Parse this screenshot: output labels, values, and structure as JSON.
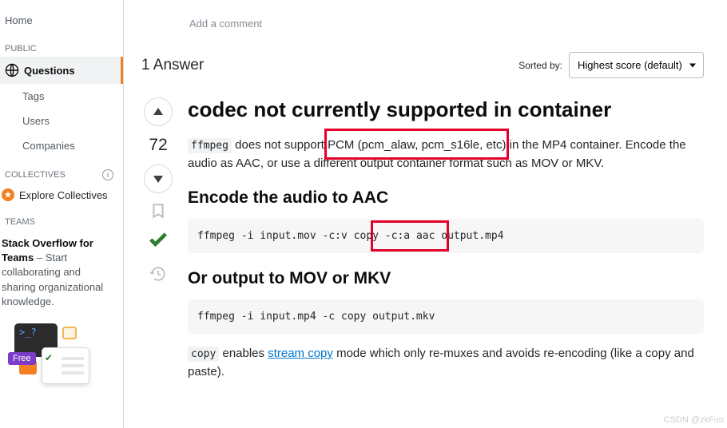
{
  "sidebar": {
    "home": "Home",
    "public_label": "PUBLIC",
    "questions": "Questions",
    "tags": "Tags",
    "users": "Users",
    "companies": "Companies",
    "collectives_label": "COLLECTIVES",
    "explore_collectives": "Explore Collectives",
    "teams_label": "TEAMS",
    "teams_promo_bold": "Stack Overflow for Teams",
    "teams_promo_rest": " – Start collaborating and sharing organizational knowledge.",
    "free_tag": "Free",
    "terminal_prompt": ">_",
    "terminal_q": "?"
  },
  "comment_cta": "Add a comment",
  "answers": {
    "count_label": "1 Answer",
    "sorted_by": "Sorted by:",
    "sort_option": "Highest score (default)"
  },
  "vote": {
    "score": "72"
  },
  "answer": {
    "title": "codec not currently supported in container",
    "para1_pre": " does not support ",
    "para1_pcm": "PCM (pcm_alaw, pcm_s16le, etc)",
    "para1_post": " in the MP4 container. Encode the audio as AAC, or use a different output container format such as MOV or MKV.",
    "ffmpeg_code": "ffmpeg",
    "h_encode": "Encode the audio to AAC",
    "code1_pre": "ffmpeg -i input.mov -c:v cop",
    "code1_y": "y",
    "code1_mid": " -c:a aac o",
    "code1_post": "utput.mp4",
    "h_or": "Or output to MOV or MKV",
    "code2": "ffmpeg -i input.mp4 -c copy output.mkv",
    "copy_code": "copy",
    "para2_pre": " enables ",
    "para2_link": "stream copy",
    "para2_post": " mode which only re-muxes and avoids re-encoding (like a copy and paste)."
  },
  "watermark": "CSDN @zkFun"
}
